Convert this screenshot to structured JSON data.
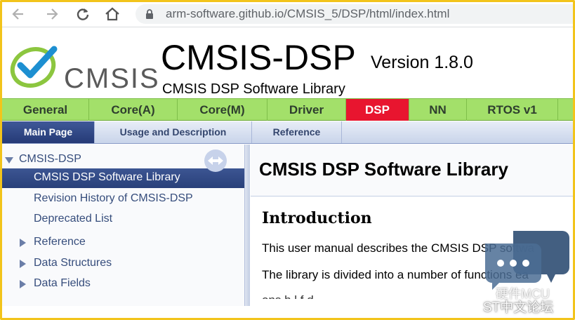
{
  "browser": {
    "url": "arm-software.github.io/CMSIS_5/DSP/html/index.html"
  },
  "header": {
    "logo_text": "CMSIS",
    "project_name": "CMSIS-DSP",
    "project_number": "Version 1.8.0",
    "project_brief": "CMSIS DSP Software Library"
  },
  "component_tabs": [
    {
      "label": "General",
      "active": false
    },
    {
      "label": "Core(A)",
      "active": false
    },
    {
      "label": "Core(M)",
      "active": false
    },
    {
      "label": "Driver",
      "active": false
    },
    {
      "label": "DSP",
      "active": true
    },
    {
      "label": "NN",
      "active": false
    },
    {
      "label": "RTOS v1",
      "active": false
    }
  ],
  "nav_tabs": [
    {
      "label": "Main Page",
      "active": true
    },
    {
      "label": "Usage and Description",
      "active": false
    },
    {
      "label": "Reference",
      "active": false
    }
  ],
  "side_nav": {
    "items": [
      {
        "label": "CMSIS-DSP",
        "expander": "expanded"
      },
      {
        "label": "CMSIS DSP Software Library",
        "expander": "none",
        "selected": true
      },
      {
        "label": "Revision History of CMSIS-DSP",
        "expander": "none"
      },
      {
        "label": "Deprecated List",
        "expander": "none"
      },
      {
        "label": "Reference",
        "expander": "collapsed"
      },
      {
        "label": "Data Structures",
        "expander": "collapsed"
      },
      {
        "label": "Data Fields",
        "expander": "collapsed"
      }
    ]
  },
  "content": {
    "title": "CMSIS DSP Software Library",
    "section_heading": "Introduction",
    "paragraphs": [
      "This user manual describes the CMSIS DSP softwa",
      "The library is divided into a number of functions ea",
      "ons   h   l   f   d   "
    ]
  },
  "watermark": {
    "line1": "硬件MCU",
    "line2": "ST中文论坛"
  },
  "colors": {
    "frame_border": "#f2c41b",
    "component_tab_bg": "#a3e06a",
    "component_tab_active": "#e8152f",
    "nav_tab_active": "#2f457f",
    "logo_check": "#1d8fd1",
    "logo_swoosh": "#8cc63f"
  }
}
